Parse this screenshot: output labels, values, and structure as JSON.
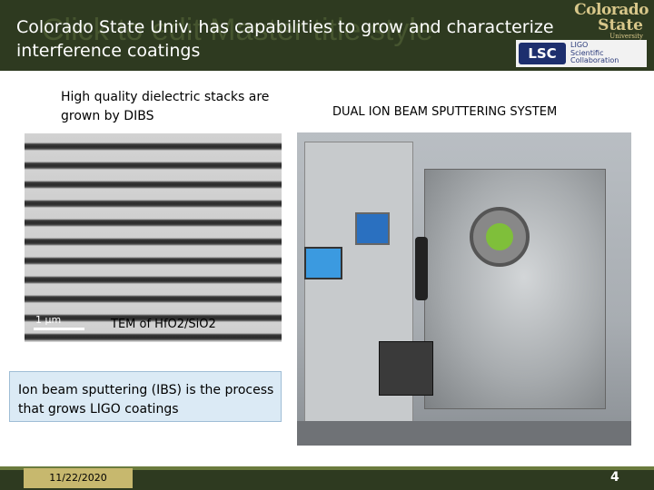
{
  "header": {
    "ghost_title": "Click to edit Master title style",
    "title": "Colorado State Univ. has capabilities to grow and characterize interference coatings"
  },
  "logos": {
    "csu_line1": "Colorado",
    "csu_line2": "State",
    "csu_line3": "University",
    "lsc_badge": "LSC",
    "lsc_line1": "LIGO",
    "lsc_line2": "Scientific",
    "lsc_line3": "Collaboration"
  },
  "left_panel": {
    "caption": "High quality dielectric stacks are grown by DIBS",
    "tem_scale": "1 μm",
    "tem_caption": "TEM of  HfO2/SiO2"
  },
  "right_panel": {
    "caption": "DUAL ION BEAM SPUTTERING SYSTEM"
  },
  "note": {
    "text": "Ion beam sputtering (IBS) is the process that grows  LIGO coatings"
  },
  "footer": {
    "date": "11/22/2020",
    "page": "4"
  },
  "colors": {
    "header_bg": "#2e3a20",
    "accent_gold": "#c7b86e",
    "note_bg": "#dbeaf5"
  }
}
